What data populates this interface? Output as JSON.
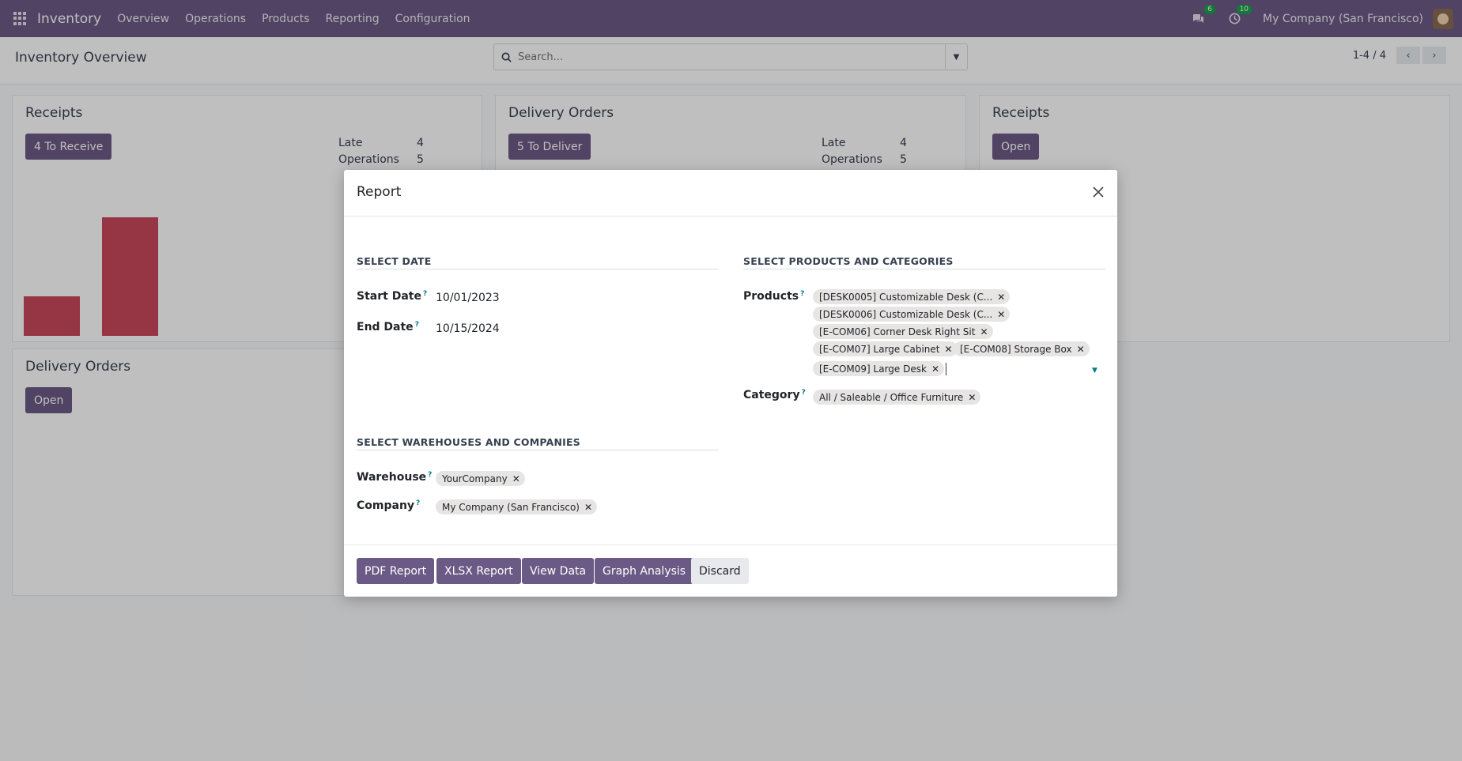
{
  "navbar": {
    "brand": "Inventory",
    "menu": [
      "Overview",
      "Operations",
      "Products",
      "Reporting",
      "Configuration"
    ],
    "messages_count": "6",
    "activities_count": "10",
    "company": "My Company (San Francisco)"
  },
  "control_panel": {
    "title": "Inventory Overview",
    "search_placeholder": "Search...",
    "pager": "1-4 / 4"
  },
  "cards": [
    {
      "title": "Receipts",
      "button": "4 To Receive",
      "late_label": "Late",
      "late_value": "4",
      "ops_label": "Operations",
      "ops_value": "5"
    },
    {
      "title": "Delivery Orders",
      "button": "5 To Deliver",
      "late_label": "Late",
      "late_value": "4",
      "ops_label": "Operations",
      "ops_value": "5"
    },
    {
      "title": "Receipts",
      "button": "Open"
    },
    {
      "title": "Delivery Orders",
      "button": "Open"
    }
  ],
  "bar_chart": {
    "values": [
      0.28,
      0.68
    ],
    "color": "#c8475a"
  },
  "modal": {
    "title": "Report",
    "date_section": "SELECT DATE",
    "start_date_label": "Start Date",
    "start_date": "10/01/2023",
    "end_date_label": "End Date",
    "end_date": "10/15/2024",
    "help_mark": "?",
    "warehouse_section": "SELECT WAREHOUSES AND COMPANIES",
    "warehouse_label": "Warehouse",
    "warehouse_tag": "YourCompany",
    "company_label": "Company",
    "company_tag": "My Company (San Francisco)",
    "products_section": "SELECT PRODUCTS AND CATEGORIES",
    "products_label": "Products",
    "products": [
      "[DESK0005] Customizable Desk (C...",
      "[DESK0006] Customizable Desk (C...",
      "[E-COM06] Corner Desk Right Sit",
      "[E-COM07] Large Cabinet",
      "[E-COM08] Storage Box",
      "[E-COM09] Large Desk"
    ],
    "category_label": "Category",
    "category_tag": "All / Saleable / Office Furniture",
    "tag_remove": "✕",
    "buttons": {
      "pdf": "PDF Report",
      "xlsx": "XLSX Report",
      "view": "View Data",
      "graph": "Graph Analysis",
      "discard": "Discard"
    }
  }
}
